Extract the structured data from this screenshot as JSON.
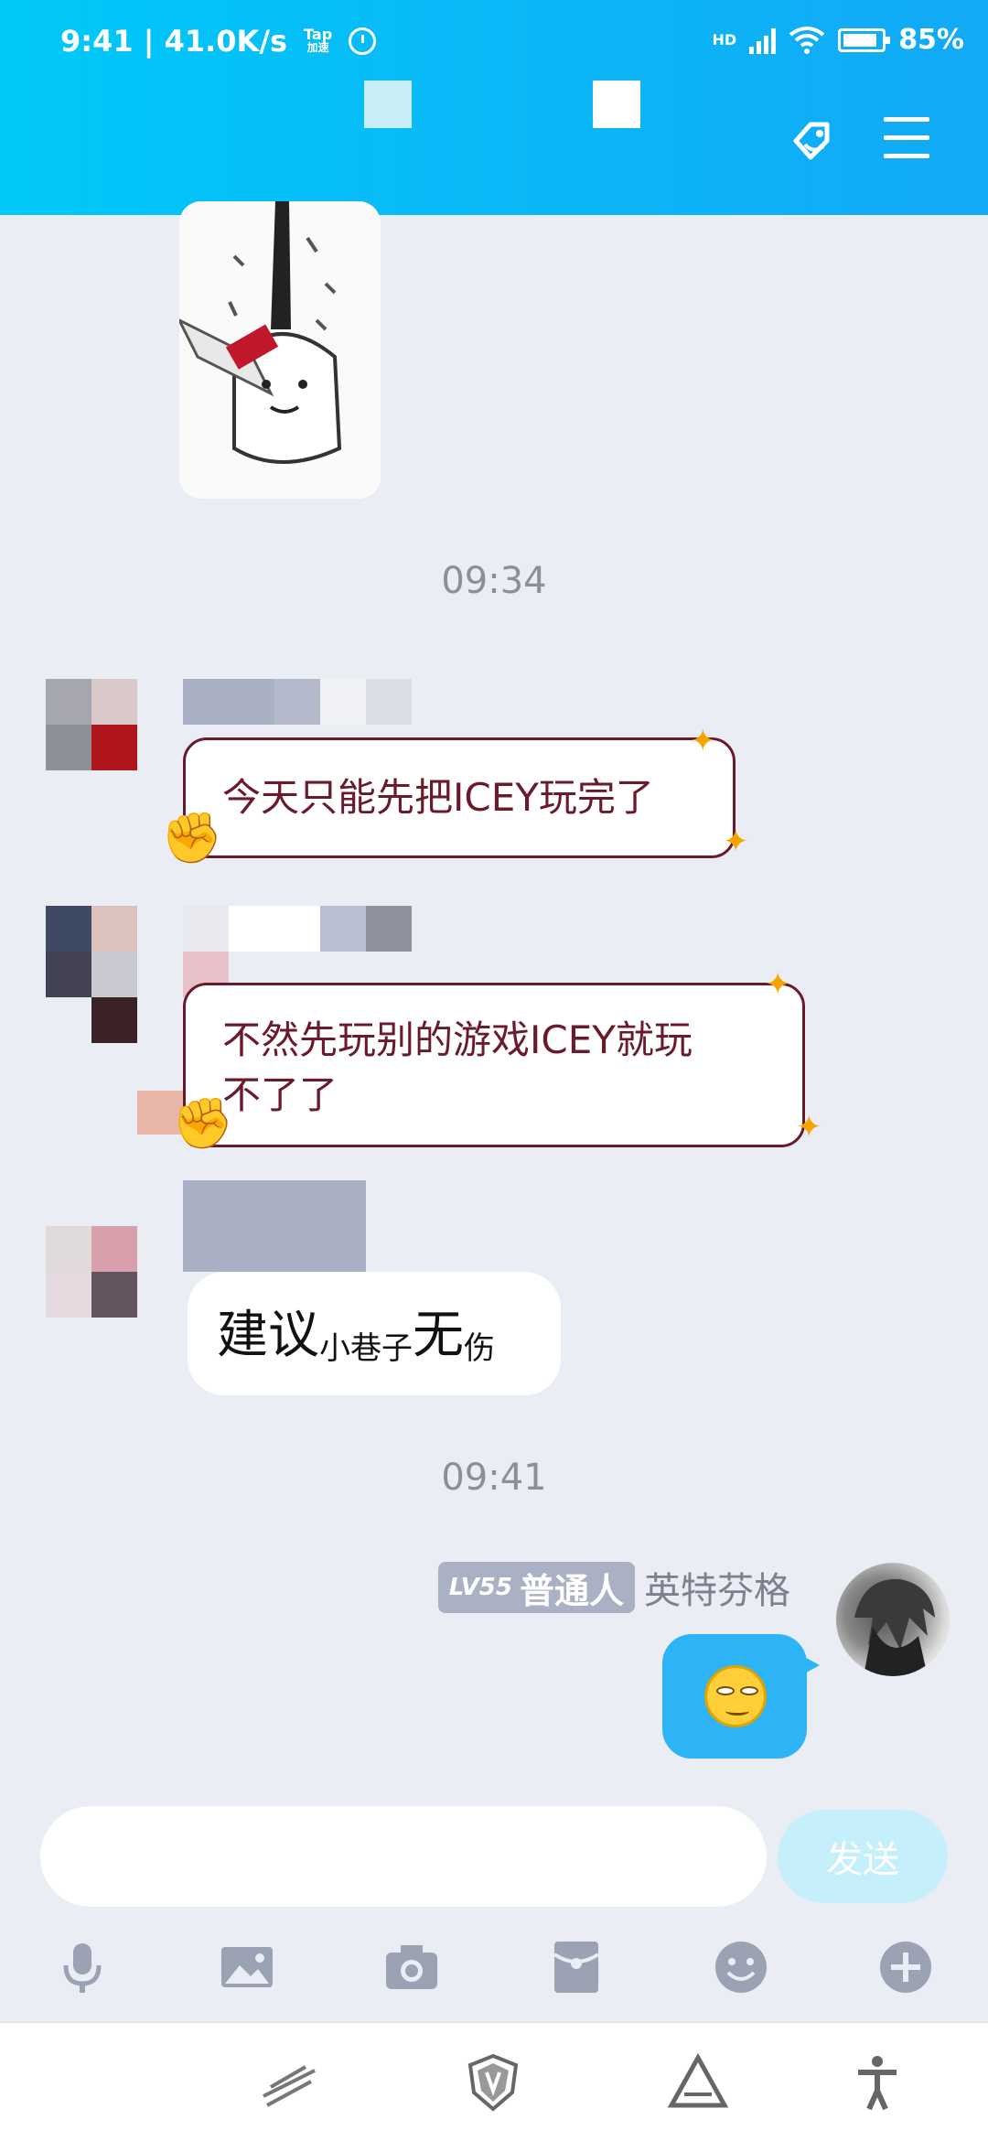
{
  "status_bar": {
    "time_speed": "9:41 | 41.0K/s",
    "tap_label_1": "Tap",
    "tap_label_2": "加速",
    "network": "HD",
    "battery": "85%"
  },
  "messages": {
    "time_1": "09:34",
    "msg_1": "今天只能先把ICEY玩完了",
    "msg_2_line1": "不然先玩别的游戏ICEY就玩",
    "msg_2_line2": "不了了",
    "msg_3_a": "建议",
    "msg_3_b": "小巷子",
    "msg_3_c": "无",
    "msg_3_d": "伤",
    "time_2": "09:41"
  },
  "self": {
    "level": "LV55",
    "rank": "普通人",
    "name": "英特芬格"
  },
  "composer": {
    "send_label": "发送",
    "input_value": ""
  },
  "colors": {
    "header_start": "#00c8f8",
    "header_end": "#12a9f5",
    "self_bubble": "#2db4f7",
    "fancy_bubble_border": "#6a1a2a"
  }
}
